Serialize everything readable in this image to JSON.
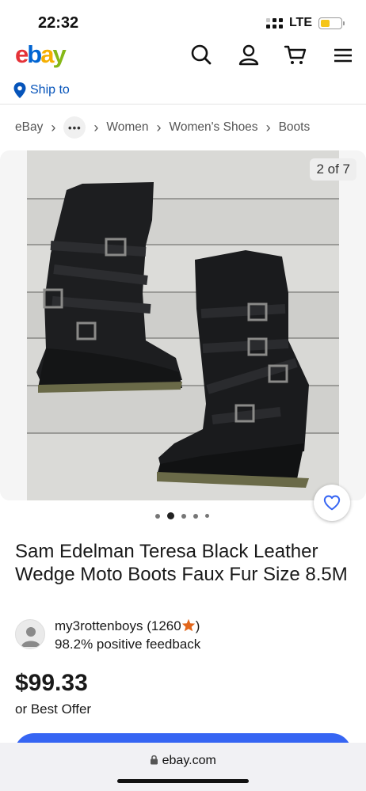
{
  "status_bar": {
    "time": "22:32",
    "network": "LTE",
    "battery_level": 0.45,
    "battery_color": "#f5c518"
  },
  "header": {
    "logo_letters": [
      "e",
      "b",
      "a",
      "y"
    ],
    "logo_colors": [
      "#e53238",
      "#0064d2",
      "#f5af02",
      "#86b817"
    ],
    "icons": [
      "search-icon",
      "account-icon",
      "cart-icon",
      "menu-icon"
    ]
  },
  "ship_to": {
    "label": "Ship to",
    "icon": "location-pin-icon"
  },
  "breadcrumb": {
    "items": [
      "eBay",
      "Women",
      "Women's Shoes",
      "Boots"
    ],
    "more_icon": "more-dots-icon"
  },
  "gallery": {
    "counter": "2 of 7",
    "image_description_icon": "product-photo-boots",
    "dot_count": 5,
    "active_index": 1
  },
  "listing": {
    "title": "Sam Edelman Teresa Black Leather Wedge Moto Boots Faux Fur Size 8.5M",
    "seller_name": "my3rottenboys",
    "feedback_count_open": "(1260",
    "feedback_count_close": ")",
    "feedback_star_icon": "star-icon",
    "feedback_percent": "98.2% positive feedback",
    "price": "$99.33",
    "offer": "or Best Offer"
  },
  "browser": {
    "url": "ebay.com",
    "lock_icon": "lock-icon"
  },
  "colors": {
    "link_blue": "#0654ba",
    "button_blue": "#3665f3",
    "star_orange": "#e2661b"
  }
}
